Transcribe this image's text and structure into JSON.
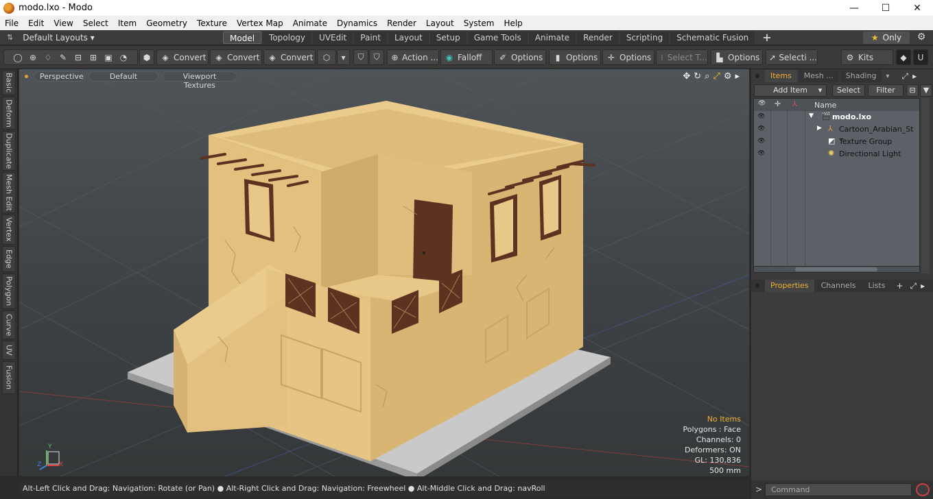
{
  "window": {
    "title": "modo.lxo - Modo",
    "minimize": "—",
    "maximize": "☐",
    "close": "✕"
  },
  "menu": [
    "File",
    "Edit",
    "View",
    "Select",
    "Item",
    "Geometry",
    "Texture",
    "Vertex Map",
    "Animate",
    "Dynamics",
    "Render",
    "Layout",
    "System",
    "Help"
  ],
  "layout_dropdown": "Default Layouts ▾",
  "tabs": [
    "Model",
    "Topology",
    "UVEdit",
    "Paint",
    "Layout",
    "Setup",
    "Game Tools",
    "Animate",
    "Render",
    "Scripting",
    "Schematic Fusion"
  ],
  "active_tab": "Model",
  "only_label": "Only",
  "toolbar": {
    "convert1": "Convert",
    "convert2": "Convert",
    "convert3": "Convert",
    "action": "Action",
    "falloff": "Falloff",
    "options1": "Options",
    "options2": "Options",
    "options3": "Options",
    "options4": "Options",
    "select_t": "Select T...",
    "selecti": "Selecti ...",
    "kits": "Kits"
  },
  "left_tabs": [
    "Basic",
    "Deform",
    "Duplicate",
    "Mesh Edit",
    "Vertex",
    "Edge",
    "Polygon",
    "Curve",
    "UV",
    "Fusion"
  ],
  "viewport": {
    "view_mode": "Perspective",
    "shading": "Default",
    "textures": "Viewport Textures",
    "info": {
      "items": "No Items",
      "polygons": "Polygons : Face",
      "channels": "Channels: 0",
      "deformers": "Deformers: ON",
      "gl": "GL: 130,836",
      "units": "500 mm"
    },
    "axis_x": "X",
    "axis_y": "Y",
    "axis_z": "Z"
  },
  "status_text": "Alt-Left Click and Drag: Navigation: Rotate (or Pan) ● Alt-Right Click and Drag: Navigation: Freewheel ● Alt-Middle Click and Drag: navRoll",
  "items_panel": {
    "tabs": [
      "Items",
      "Mesh ...",
      "Shading"
    ],
    "add_item": "Add Item",
    "select": "Select",
    "filter": "Filter",
    "name_header": "Name",
    "rows": [
      {
        "name": "modo.lxo",
        "icon": "scene-icon"
      },
      {
        "name": "Cartoon_Arabian_St ...",
        "icon": "mesh-icon"
      },
      {
        "name": "Texture Group",
        "icon": "texture-group-icon"
      },
      {
        "name": "Directional Light",
        "icon": "light-icon"
      }
    ]
  },
  "props_panel": {
    "tabs": [
      "Properties",
      "Channels",
      "Lists"
    ]
  },
  "command": {
    "placeholder": "Command",
    "prompt": ">"
  },
  "colors": {
    "accent": "#f0b030",
    "wall": "#e6c483",
    "wood": "#5c3220",
    "base": "#c8c8c8"
  }
}
